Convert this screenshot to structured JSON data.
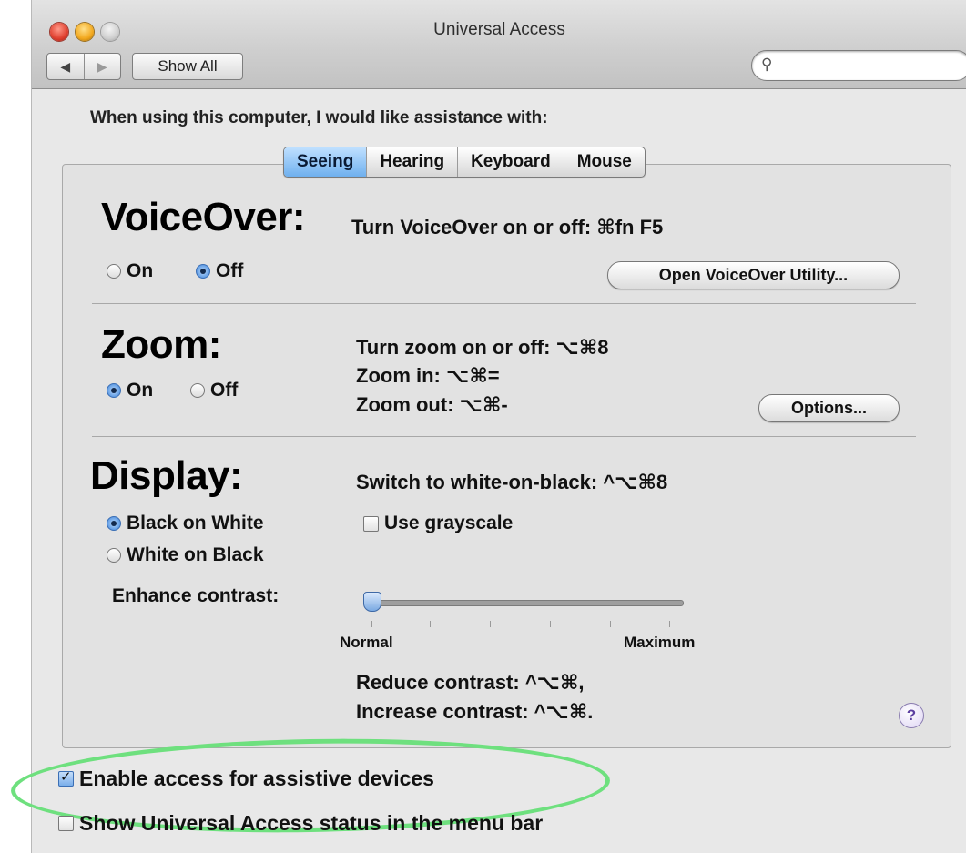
{
  "window": {
    "title": "Universal Access"
  },
  "toolbar": {
    "back_icon": "◀",
    "forward_icon": "▶",
    "show_all_label": "Show All",
    "search_icon": "🔍",
    "search_value": "",
    "search_placeholder": ""
  },
  "assist_label": "When using this computer, I would like assistance with:",
  "tabs": [
    {
      "label": "Seeing",
      "active": true
    },
    {
      "label": "Hearing",
      "active": false
    },
    {
      "label": "Keyboard",
      "active": false
    },
    {
      "label": "Mouse",
      "active": false
    }
  ],
  "voiceover": {
    "heading": "VoiceOver:",
    "shortcut": "Turn VoiceOver on or off: ⌘fn F5",
    "on_label": "On",
    "off_label": "Off",
    "selected": "Off",
    "open_utility_label": "Open VoiceOver Utility..."
  },
  "zoom": {
    "heading": "Zoom:",
    "shortcut_toggle": "Turn zoom on or off: ⌥⌘8",
    "shortcut_in": "Zoom in: ⌥⌘=",
    "shortcut_out": "Zoom out: ⌥⌘-",
    "on_label": "On",
    "off_label": "Off",
    "selected": "On",
    "options_label": "Options..."
  },
  "display": {
    "heading": "Display:",
    "shortcut": "Switch to white-on-black: ^⌥⌘8",
    "black_on_white_label": "Black on White",
    "white_on_black_label": "White on Black",
    "selected": "Black on White",
    "grayscale_label": "Use grayscale",
    "grayscale_checked": false,
    "enhance_contrast_label": "Enhance contrast:",
    "contrast_value": 0,
    "slider_min_label": "Normal",
    "slider_max_label": "Maximum",
    "reduce_shortcut": "Reduce contrast: ^⌥⌘,",
    "increase_shortcut": "Increase contrast: ^⌥⌘."
  },
  "help_icon": "?",
  "bottom": {
    "assistive_label": "Enable access for assistive devices",
    "assistive_checked": true,
    "status_label": "Show Universal Access status in the menu bar",
    "status_checked": false
  },
  "colors": {
    "highlight_ring": "#6ee07e",
    "active_tab": "#6fb0ee"
  }
}
